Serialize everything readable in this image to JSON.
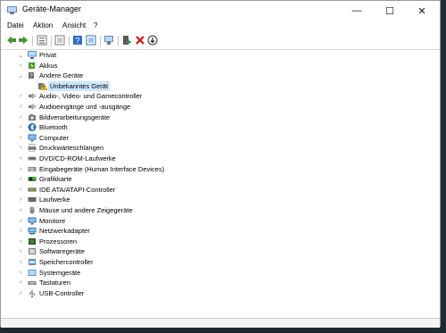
{
  "window": {
    "title": "Geräte-Manager"
  },
  "controls": {
    "minimize": "—",
    "maximize": "☐",
    "close": "✕"
  },
  "menu": [
    "Datei",
    "Aktion",
    "Ansicht",
    "?"
  ],
  "tree": {
    "root": "Privat",
    "items": [
      {
        "label": "Akkus",
        "icon": "battery-icon",
        "expanded": false
      },
      {
        "label": "Andere Geräte",
        "icon": "other-devices-icon",
        "expanded": true,
        "children": [
          {
            "label": "Unbekanntes Gerät",
            "icon": "unknown-device-warning-icon",
            "selected": true
          }
        ]
      },
      {
        "label": "Audio-, Video- und Gamecontroller",
        "icon": "speaker-icon",
        "expanded": false
      },
      {
        "label": "Audioeingänge und -ausgänge",
        "icon": "speaker-icon",
        "expanded": false
      },
      {
        "label": "Bildverarbeitungsgeräte",
        "icon": "camera-icon",
        "expanded": false
      },
      {
        "label": "Bluetooth",
        "icon": "bluetooth-icon",
        "expanded": false
      },
      {
        "label": "Computer",
        "icon": "monitor-icon",
        "expanded": false
      },
      {
        "label": "Druckwarteschlangen",
        "icon": "printer-icon",
        "expanded": false
      },
      {
        "label": "DVD/CD-ROM-Laufwerke",
        "icon": "disc-drive-icon",
        "expanded": false
      },
      {
        "label": "Eingabegeräte (Human Interface Devices)",
        "icon": "hid-icon",
        "expanded": false
      },
      {
        "label": "Grafikkarte",
        "icon": "graphics-card-icon",
        "expanded": false
      },
      {
        "label": "IDE ATA/ATAPI-Controller",
        "icon": "ide-controller-icon",
        "expanded": false
      },
      {
        "label": "Laufwerke",
        "icon": "drive-icon",
        "expanded": false
      },
      {
        "label": "Mäuse und andere Zeigegeräte",
        "icon": "mouse-icon",
        "expanded": false
      },
      {
        "label": "Monitore",
        "icon": "monitor-icon",
        "expanded": false
      },
      {
        "label": "Netzwerkadapter",
        "icon": "network-adapter-icon",
        "expanded": false
      },
      {
        "label": "Prozessoren",
        "icon": "processor-icon",
        "expanded": false
      },
      {
        "label": "Softwaregeräte",
        "icon": "software-device-icon",
        "expanded": false
      },
      {
        "label": "Speichercontroller",
        "icon": "storage-controller-icon",
        "expanded": false
      },
      {
        "label": "Systemgeräte",
        "icon": "system-devices-icon",
        "expanded": false
      },
      {
        "label": "Tastaturen",
        "icon": "keyboard-icon",
        "expanded": false
      },
      {
        "label": "USB-Controller",
        "icon": "usb-icon",
        "expanded": false
      }
    ]
  },
  "colors": {
    "selection": "#cce8ff",
    "accent": "#0063b1",
    "warning": "#f2c12e"
  }
}
